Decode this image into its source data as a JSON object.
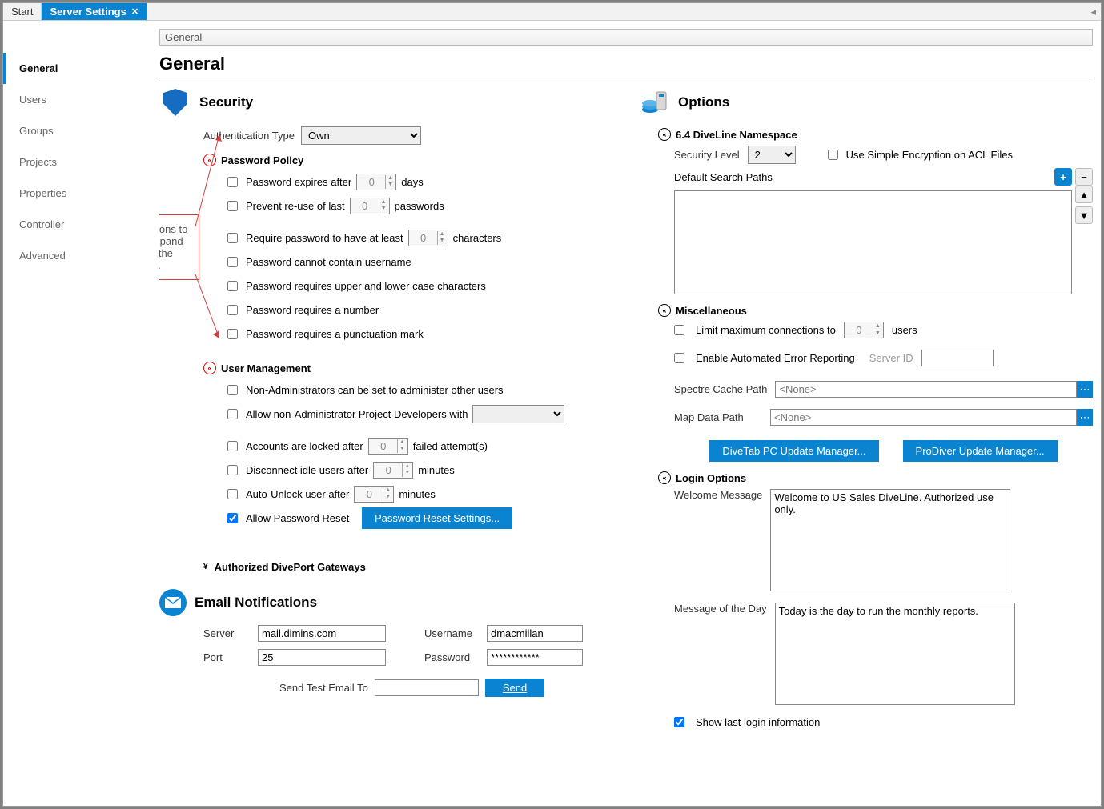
{
  "tabs": {
    "start": "Start",
    "server": "Server Settings"
  },
  "sidebar": [
    "General",
    "Users",
    "Groups",
    "Projects",
    "Properties",
    "Controller",
    "Advanced"
  ],
  "breadcrumb": "General",
  "page_title": "General",
  "callout": "Click the chevrons to collapse or expand sections of the interface.",
  "security": {
    "title": "Security",
    "auth_label": "Authentication Type",
    "auth_value": "Own",
    "policy_title": "Password Policy",
    "expires": "Password expires after",
    "expires_val": "0",
    "days": "days",
    "reuse": "Prevent re-use of last",
    "reuse_val": "0",
    "passwords": "passwords",
    "minlen": "Require password to have at least",
    "minlen_val": "0",
    "characters": "characters",
    "no_user": "Password cannot contain username",
    "upper_lower": "Password requires upper and lower case characters",
    "number": "Password requires a number",
    "punct": "Password requires a punctuation mark",
    "um_title": "User Management",
    "non_admin": "Non-Administrators can be set to administer other users",
    "allow_devs": "Allow non-Administrator Project Developers with",
    "lock_after": "Accounts are locked after",
    "lock_val": "0",
    "attempts": "failed attempt(s)",
    "disconnect": "Disconnect idle users after",
    "disc_val": "0",
    "minutes": "minutes",
    "autounlock": "Auto-Unlock user after",
    "au_val": "0",
    "allow_reset": "Allow Password Reset",
    "reset_btn": "Password Reset Settings...",
    "gateways": "Authorized DivePort Gateways"
  },
  "email": {
    "title": "Email Notifications",
    "server_lbl": "Server",
    "server_val": "mail.dimins.com",
    "port_lbl": "Port",
    "port_val": "25",
    "user_lbl": "Username",
    "user_val": "dmacmillan",
    "pass_lbl": "Password",
    "pass_val": "************",
    "send_to": "Send Test Email To",
    "send_btn": "Send"
  },
  "options": {
    "title": "Options",
    "ns_title": "6.4 DiveLine Namespace",
    "sec_level_lbl": "Security Level",
    "sec_level_val": "2",
    "simple_enc": "Use Simple Encryption on ACL Files",
    "search_paths": "Default Search Paths",
    "misc_title": "Miscellaneous",
    "limit_conn": "Limit maximum connections to",
    "limit_val": "0",
    "users": "users",
    "err_report": "Enable Automated Error Reporting",
    "server_id": "Server ID",
    "cache_lbl": "Spectre Cache Path",
    "none": "<None>",
    "map_lbl": "Map Data Path",
    "divetab_btn": "DiveTab PC Update Manager...",
    "prodiver_btn": "ProDiver Update Manager...",
    "login_title": "Login Options",
    "welcome_lbl": "Welcome Message",
    "welcome_val": "Welcome to US Sales DiveLine. Authorized use only.",
    "motd_lbl": "Message of the Day",
    "motd_val": "Today is the day to run the monthly reports.",
    "show_last": "Show last login information"
  }
}
